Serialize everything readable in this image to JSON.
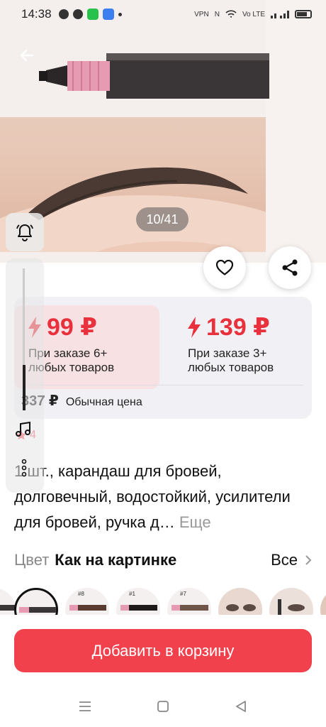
{
  "status_bar": {
    "time": "14:38",
    "right_labels": [
      "VPN",
      "N",
      "Vo LTE"
    ]
  },
  "gallery": {
    "counter": "10/41",
    "icons": {
      "back": "arrow-left-icon",
      "favorite": "heart-icon",
      "share": "share-icon"
    }
  },
  "side_widget": {
    "icons": [
      "bell-icon",
      "music-note-icon",
      "dots-icon"
    ]
  },
  "prices": {
    "tiers": [
      {
        "price": "99 ₽",
        "condition_line1": "При заказе 6+",
        "condition_line2": "любых товаров"
      },
      {
        "price": "139 ₽",
        "condition_line1": "При заказе 3+",
        "condition_line2": "любых товаров"
      }
    ],
    "regular_price": "337 ₽",
    "regular_label": "Обычная цена",
    "accent_color": "#e8313d"
  },
  "rating": {
    "value": "4"
  },
  "product": {
    "title": "1 шт., карандаш для бровей, долговечный, водостойкий, усилители для бровей, ручка д…",
    "more": "Еще"
  },
  "color_selector": {
    "label": "Цвет",
    "value": "Как на картинке",
    "all": "Все"
  },
  "swatches": [
    "",
    "#8",
    "#1",
    "#7",
    "",
    ""
  ],
  "cta": {
    "label": "Добавить в корзину",
    "color": "#f1414d"
  }
}
